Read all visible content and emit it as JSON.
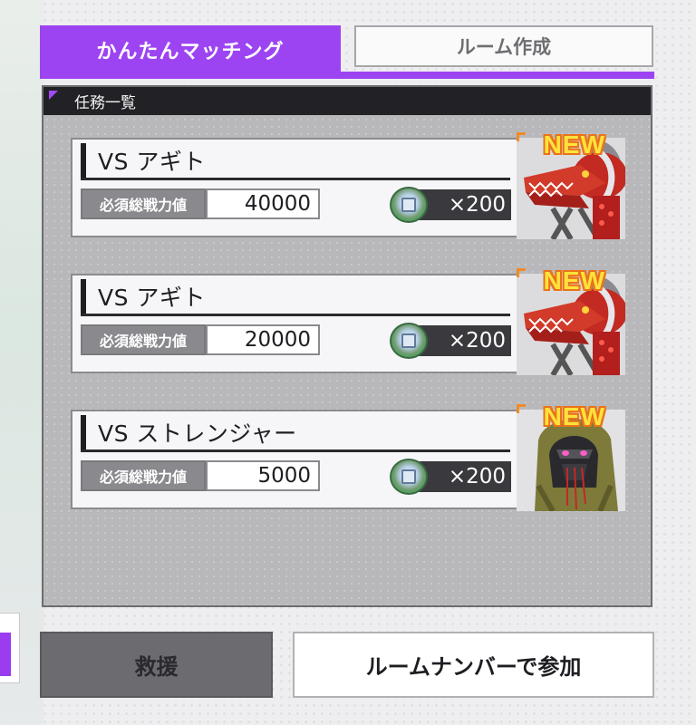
{
  "tabs": {
    "active_label": "かんたんマッチング",
    "inactive_label": "ルーム作成"
  },
  "panel": {
    "header": "任務一覧"
  },
  "missions": [
    {
      "title": "VS アギト",
      "power_label": "必須総戦力値",
      "power_value": "40000",
      "reward": "×200",
      "badge": "NEW",
      "portrait_icon": "red-dragon-portrait"
    },
    {
      "title": "VS アギト",
      "power_label": "必須総戦力値",
      "power_value": "20000",
      "reward": "×200",
      "badge": "NEW",
      "portrait_icon": "red-dragon-portrait"
    },
    {
      "title": "VS ストレンジャー",
      "power_label": "必須総戦力値",
      "power_value": "5000",
      "reward": "×200",
      "badge": "NEW",
      "portrait_icon": "hooded-figure-portrait"
    }
  ],
  "buttons": {
    "rescue": "救援",
    "join_by_number": "ルームナンバーで参加"
  },
  "colors": {
    "accent": "#9d44f2",
    "badge": "#ffe23c",
    "badge_outline": "#e9731b",
    "panel": "#b8b8bb"
  }
}
